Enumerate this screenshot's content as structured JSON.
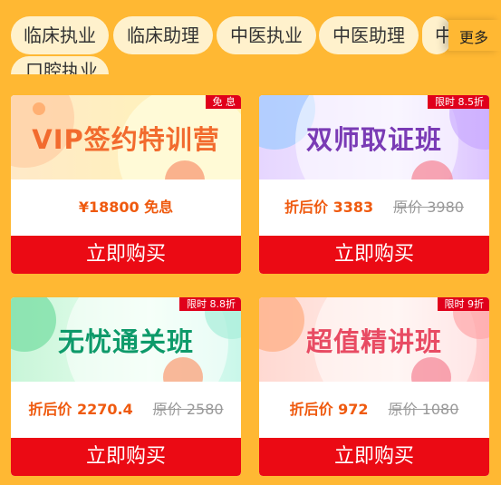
{
  "tabs": [
    "临床执业",
    "临床助理",
    "中医执业",
    "中医助理",
    "中"
  ],
  "more_label": "更多",
  "second_row_tab": "口腔执业",
  "cards": [
    {
      "title": "VIP签约特训营",
      "tag": "免 息",
      "price_now": "¥18800 免息",
      "price_old": "",
      "buy_label": "立即购买",
      "title_color": "#F26B2E"
    },
    {
      "title": "双师取证班",
      "tag": "限时 8.5折",
      "price_now": "折后价 3383",
      "price_old": "原价 3980",
      "buy_label": "立即购买",
      "title_color": "#7A3BB5"
    },
    {
      "title": "无忧通关班",
      "tag": "限时 8.8折",
      "price_now": "折后价 2270.4",
      "price_old": "原价 2580",
      "buy_label": "立即购买",
      "title_color": "#0E9A6A"
    },
    {
      "title": "超值精讲班",
      "tag": "限时 9折",
      "price_now": "折后价 972",
      "price_old": "原价 1080",
      "buy_label": "立即购买",
      "title_color": "#E84B63"
    }
  ],
  "colors": {
    "page_bg": "#FFB833",
    "tab_bg": "#FFF1CC",
    "buy_button": "#EB0A14",
    "tag_bg": "#E0001B",
    "price": "#EF5A0F"
  }
}
